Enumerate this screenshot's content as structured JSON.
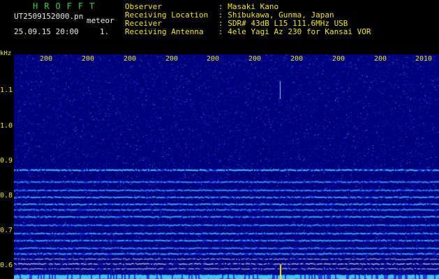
{
  "header": {
    "brand": "HROFFT",
    "filename": "UT2509152000.pn",
    "tag": "meteor",
    "datetime": "25.09.15 20:00",
    "page": "1.",
    "fields": [
      {
        "label": "Observer",
        "value": ": Masaki Kano"
      },
      {
        "label": "Receiving Location",
        "value": ": Shibukawa, Gunma, Japan"
      },
      {
        "label": "Receiver",
        "value": ": SDR# 43dB L15 111.6MHz USB"
      },
      {
        "label": "Receiving Antenna",
        "value": ": 4ele Yagi Az 230 for Kansai VOR"
      }
    ]
  },
  "spectrogram": {
    "unit": "kHz",
    "y_ticks": [
      "1.1",
      "1.0",
      "0.9",
      "0.8",
      "0.7",
      "0.6"
    ],
    "x_ticks": [
      "200",
      "200",
      "200",
      "200",
      "200",
      "200",
      "200",
      "200",
      "200",
      "2010"
    ],
    "colors": {
      "background": "#00007a",
      "noise": "#1e3cff",
      "line": "#35c8ff",
      "axis_text": "#e8e800"
    }
  }
}
